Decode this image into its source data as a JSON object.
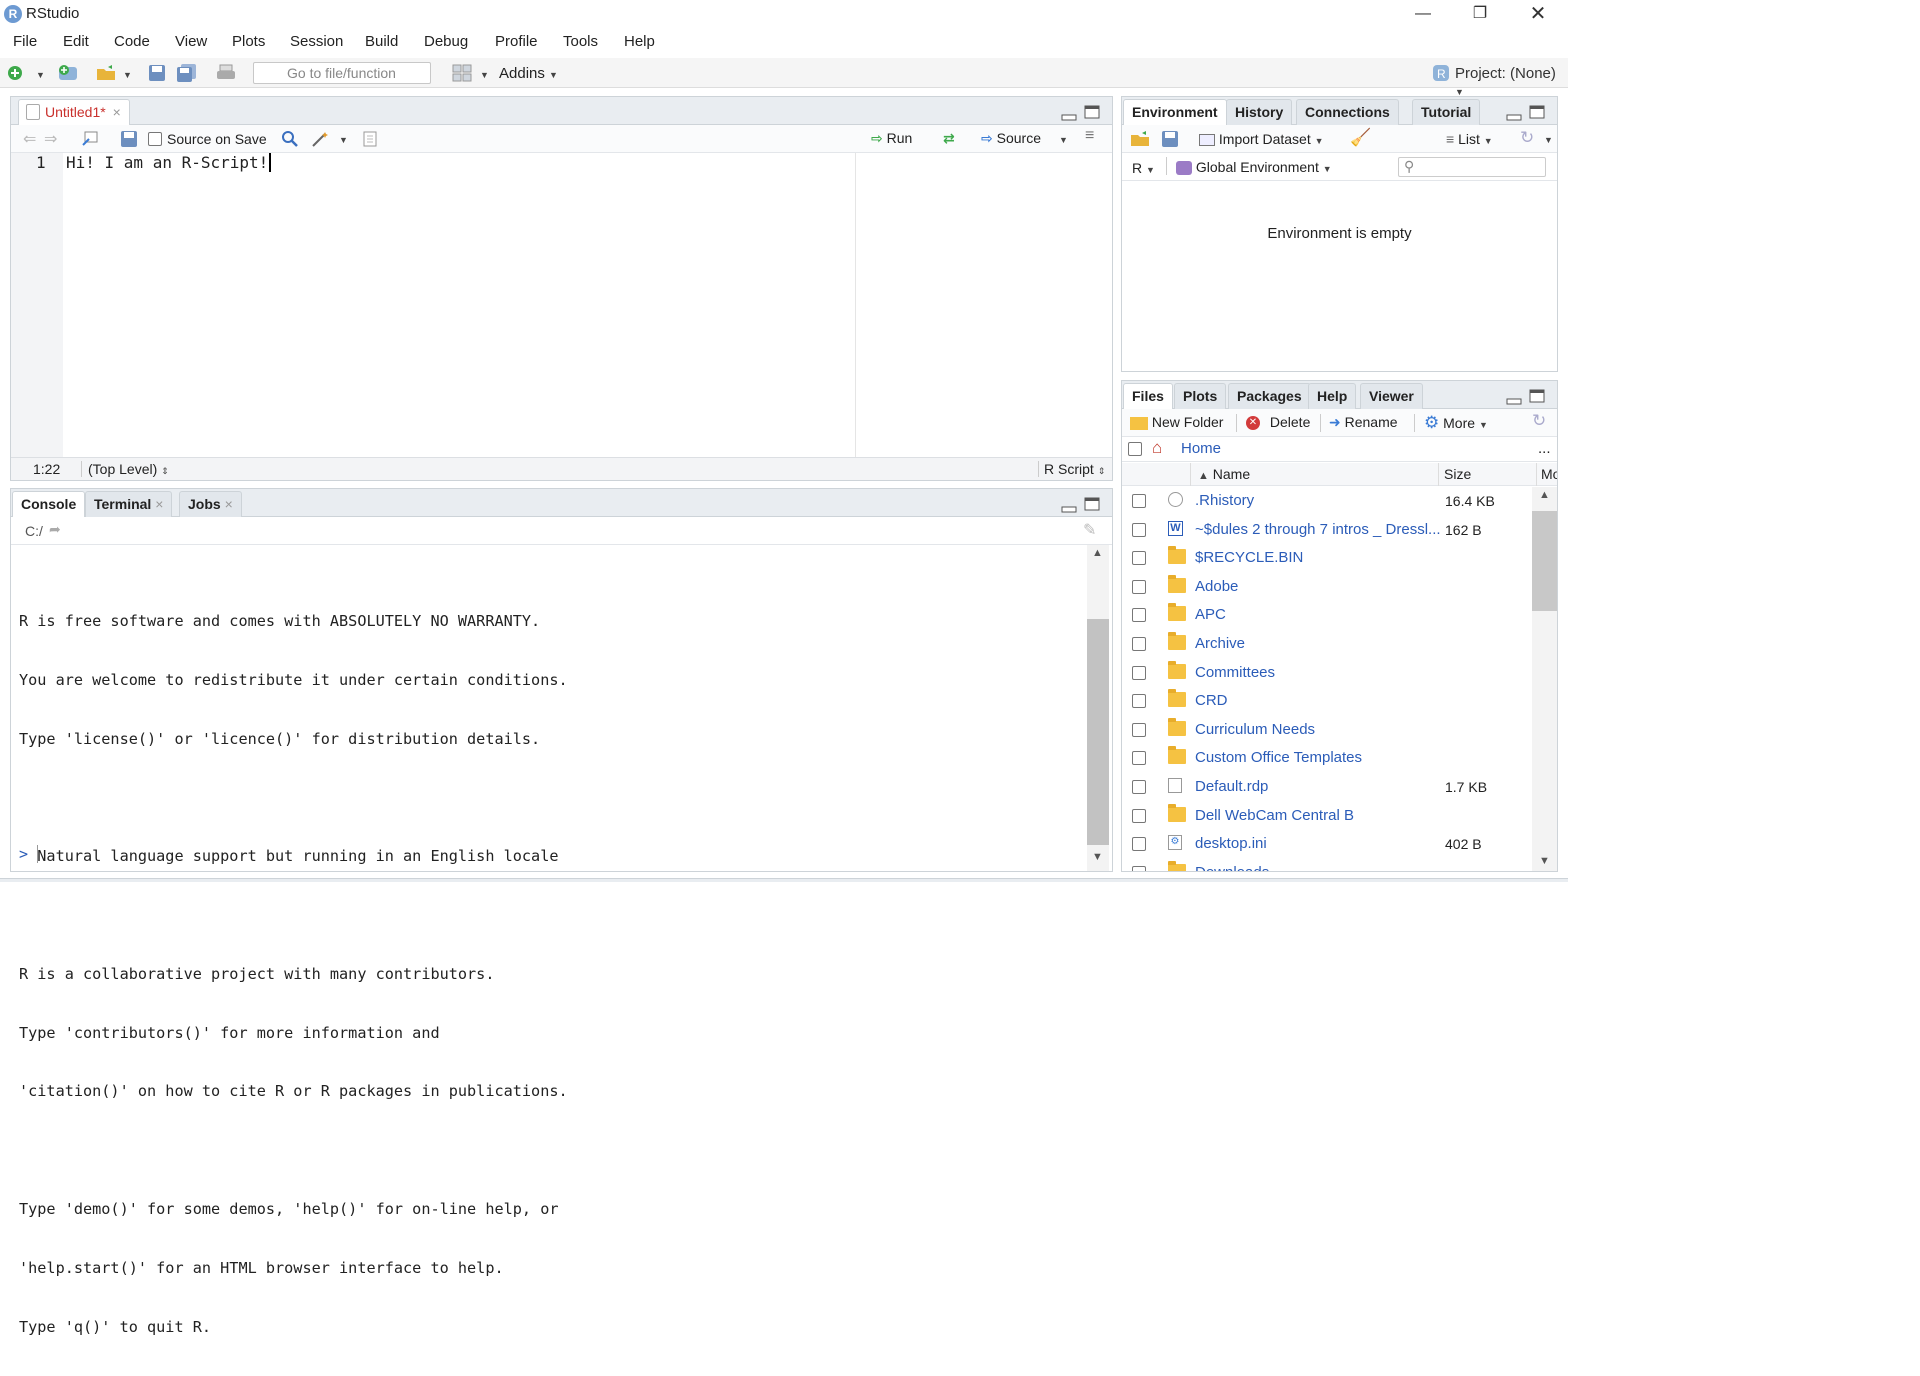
{
  "window": {
    "title": "RStudio"
  },
  "menu": [
    "File",
    "Edit",
    "Code",
    "View",
    "Plots",
    "Session",
    "Build",
    "Debug",
    "Profile",
    "Tools",
    "Help"
  ],
  "toolbar": {
    "goto_placeholder": "Go to file/function",
    "addins": "Addins",
    "project": "Project: (None)"
  },
  "editor": {
    "tab": "Untitled1*",
    "source_on_save": "Source on Save",
    "run": "Run",
    "source": "Source",
    "line_number": "1",
    "code": "Hi! I am an R-Script!",
    "status_pos": "1:22",
    "status_scope": "(Top Level)",
    "status_type": "R Script"
  },
  "console": {
    "tabs": [
      "Console",
      "Terminal",
      "Jobs"
    ],
    "path": "C:/",
    "lines": [
      "R is free software and comes with ABSOLUTELY NO WARRANTY.",
      "You are welcome to redistribute it under certain conditions.",
      "Type 'license()' or 'licence()' for distribution details.",
      "",
      "  Natural language support but running in an English locale",
      "",
      "R is a collaborative project with many contributors.",
      "Type 'contributors()' for more information and",
      "'citation()' on how to cite R or R packages in publications.",
      "",
      "Type 'demo()' for some demos, 'help()' for on-line help, or",
      "'help.start()' for an HTML browser interface to help.",
      "Type 'q()' to quit R."
    ],
    "prompt": ">"
  },
  "environment": {
    "tabs": [
      "Environment",
      "History",
      "Connections",
      "Tutorial"
    ],
    "import": "Import Dataset",
    "list": "List",
    "lang": "R",
    "scope": "Global Environment",
    "empty": "Environment is empty"
  },
  "files": {
    "tabs": [
      "Files",
      "Plots",
      "Packages",
      "Help",
      "Viewer"
    ],
    "new_folder": "New Folder",
    "delete": "Delete",
    "rename": "Rename",
    "more": "More",
    "home": "Home",
    "ellipsis": "...",
    "col_name": "Name",
    "col_size": "Size",
    "col_mod": "Mo",
    "rows": [
      {
        "name": ".Rhistory",
        "size": "16.4 KB",
        "type": "history"
      },
      {
        "name": "~$dules 2 through 7 intros _ Dressl...",
        "size": "162 B",
        "type": "word"
      },
      {
        "name": "$RECYCLE.BIN",
        "size": "",
        "type": "folder"
      },
      {
        "name": "Adobe",
        "size": "",
        "type": "folder"
      },
      {
        "name": "APC",
        "size": "",
        "type": "folder"
      },
      {
        "name": "Archive",
        "size": "",
        "type": "folder"
      },
      {
        "name": "Committees",
        "size": "",
        "type": "folder"
      },
      {
        "name": "CRD",
        "size": "",
        "type": "folder"
      },
      {
        "name": "Curriculum Needs",
        "size": "",
        "type": "folder"
      },
      {
        "name": "Custom Office Templates",
        "size": "",
        "type": "folder"
      },
      {
        "name": "Default.rdp",
        "size": "1.7 KB",
        "type": "doc"
      },
      {
        "name": "Dell WebCam Central B",
        "size": "",
        "type": "folder"
      },
      {
        "name": "desktop.ini",
        "size": "402 B",
        "type": "ini"
      },
      {
        "name": "Downloads",
        "size": "",
        "type": "folder"
      }
    ]
  }
}
